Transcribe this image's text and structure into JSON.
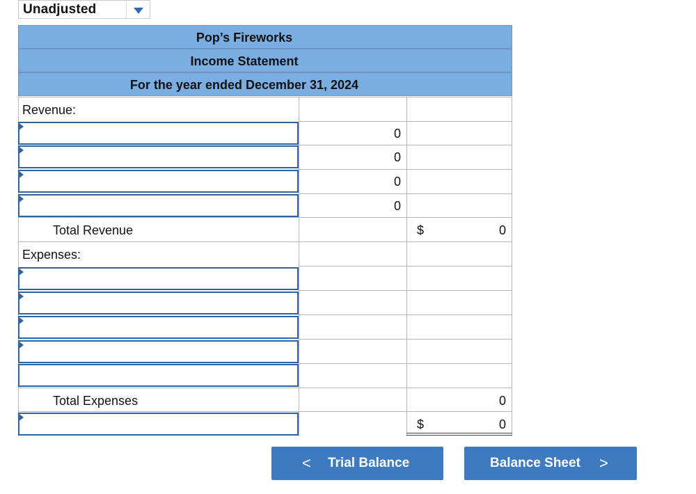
{
  "selector": {
    "value": "Unadjusted",
    "icon": "chevron-down-icon"
  },
  "statement": {
    "company": "Pop’s Fireworks",
    "title": "Income Statement",
    "period": "For the year ended December 31, 2024"
  },
  "revenue": {
    "heading": "Revenue:",
    "rows": [
      {
        "account": "",
        "amount": "0"
      },
      {
        "account": "",
        "amount": "0"
      },
      {
        "account": "",
        "amount": "0"
      },
      {
        "account": "",
        "amount": "0"
      }
    ],
    "total_label": "Total Revenue",
    "total_currency": "$",
    "total_value": "0"
  },
  "expenses": {
    "heading": "Expenses:",
    "rows": [
      {
        "account": "",
        "amount": ""
      },
      {
        "account": "",
        "amount": ""
      },
      {
        "account": "",
        "amount": ""
      },
      {
        "account": "",
        "amount": ""
      },
      {
        "account": "",
        "amount": ""
      }
    ],
    "total_label": "Total Expenses",
    "total_value": "0"
  },
  "net": {
    "account": "",
    "currency": "$",
    "value": "0"
  },
  "nav": {
    "prev_label": "Trial Balance",
    "prev_icon": "<",
    "next_label": "Balance Sheet",
    "next_icon": ">"
  },
  "colors": {
    "header_bg": "#7aaee3",
    "input_border": "#2e64a4",
    "button_bg": "#3e7ac0"
  }
}
